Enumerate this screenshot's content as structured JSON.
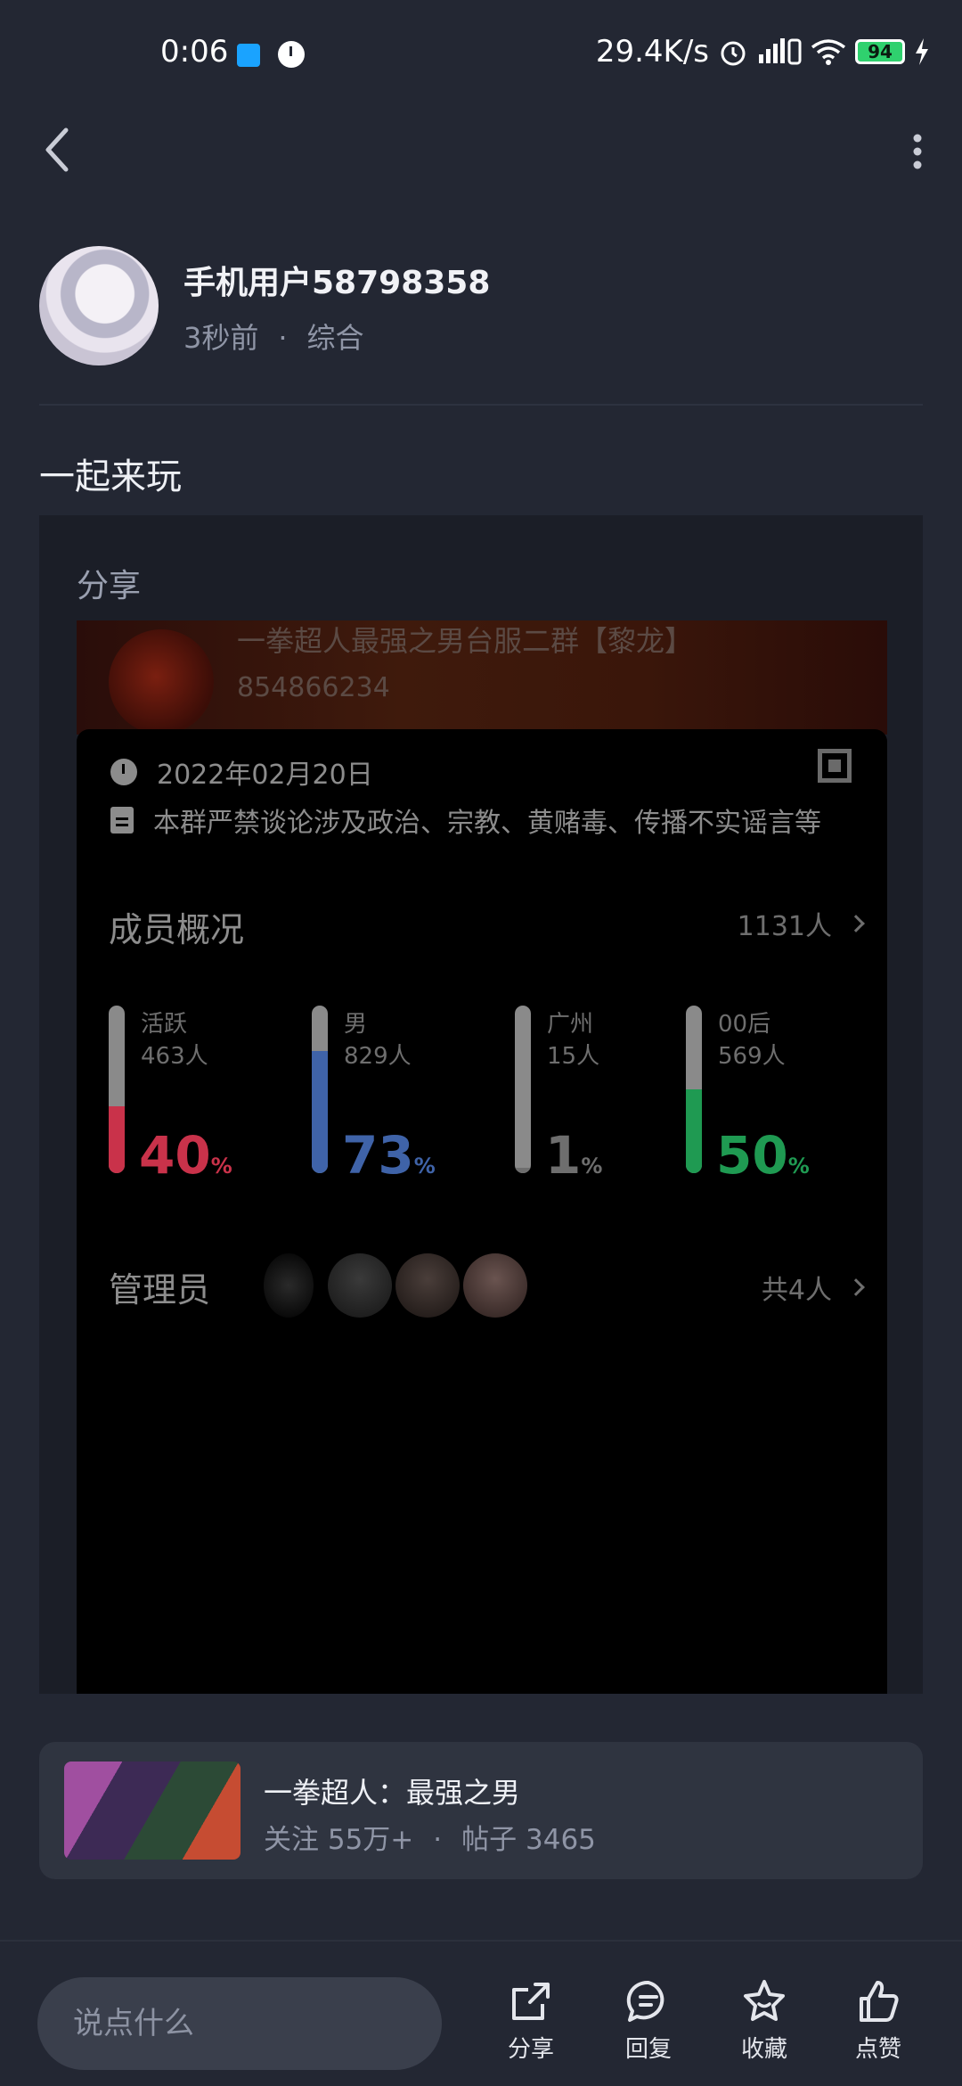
{
  "status_bar": {
    "time": "0:06",
    "network_speed": "29.4K/s",
    "battery": "94",
    "icons": [
      "alarm-icon",
      "signal-icon",
      "wifi-icon",
      "battery-icon",
      "charging-icon"
    ]
  },
  "header": {
    "back_icon": "chevron-left-icon",
    "more_icon": "more-vertical-icon"
  },
  "author": {
    "name": "手机用户58798358",
    "time": "3秒前",
    "separator": "·",
    "category": "综合"
  },
  "post": {
    "title": "一起来玩"
  },
  "share": {
    "label": "分享",
    "group": {
      "name": "一拳超人最强之男台服二群【黎龙】",
      "id": "854866234",
      "date": "2022年02月20日",
      "notice": "本群严禁谈论涉及政治、宗教、黄赌毒、传播不实谣言等",
      "members_title": "成员概况",
      "members_total": "1131人",
      "stats": [
        {
          "label": "活跃",
          "count": "463人",
          "percent": "40",
          "unit": "%",
          "fraction": 0.4,
          "color": "#c9324a"
        },
        {
          "label": "男",
          "count": "829人",
          "percent": "73",
          "unit": "%",
          "fraction": 0.73,
          "color": "#3f63a8"
        },
        {
          "label": "广州",
          "count": "15人",
          "percent": "1",
          "unit": "%",
          "fraction": 0.01,
          "color": "#6e6e6e"
        },
        {
          "label": "00后",
          "count": "569人",
          "percent": "50",
          "unit": "%",
          "fraction": 0.5,
          "color": "#1f9a52"
        }
      ],
      "admins_title": "管理员",
      "admins_total": "共4人"
    }
  },
  "topic": {
    "title": "一拳超人：最强之男",
    "follow_label": "关注",
    "follow_count": "55万+",
    "separator": "·",
    "posts_label": "帖子",
    "posts_count": "3465"
  },
  "bottom_bar": {
    "input_placeholder": "说点什么",
    "actions": [
      {
        "label": "分享",
        "icon": "share-icon"
      },
      {
        "label": "回复",
        "icon": "comment-icon"
      },
      {
        "label": "收藏",
        "icon": "star-icon"
      },
      {
        "label": "点赞",
        "icon": "thumbs-up-icon"
      }
    ]
  }
}
